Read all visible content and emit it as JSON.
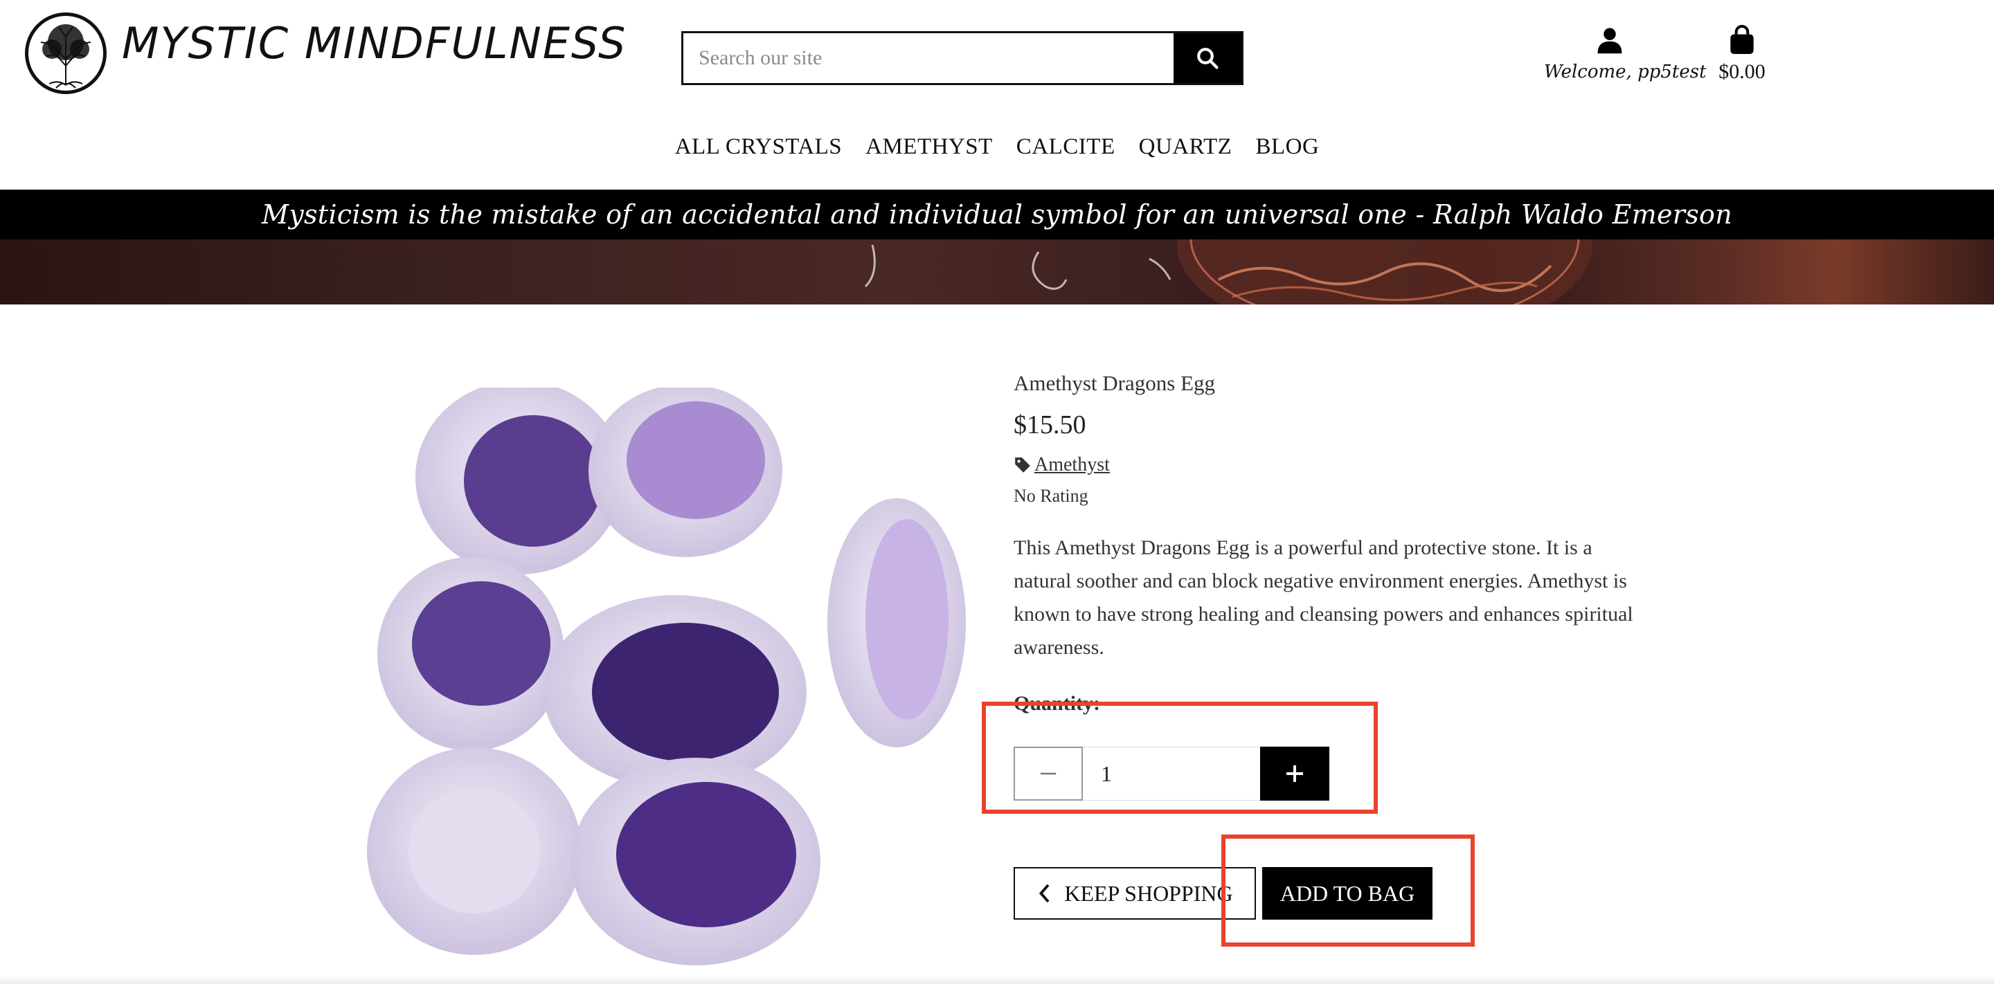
{
  "header": {
    "brand": "MYSTIC MINDFULNESS",
    "search_placeholder": "Search our site",
    "account_label": "Welcome, pp5test",
    "bag_total": "$0.00"
  },
  "nav": {
    "items": [
      "ALL CRYSTALS",
      "AMETHYST",
      "CALCITE",
      "QUARTZ",
      "BLOG"
    ]
  },
  "banner": {
    "quote": "Mysticism is the mistake of an accidental and individual symbol for an universal one - Ralph Waldo Emerson"
  },
  "product": {
    "name": "Amethyst Dragons Egg",
    "price": "$15.50",
    "category": "Amethyst",
    "rating": "No Rating",
    "description": "This Amethyst Dragons Egg is a powerful and protective stone. It is a natural soother and can block negative environment energies. Amethyst is known to have strong healing and cleansing powers and enhances spiritual awareness.",
    "quantity_label": "Quantity:",
    "quantity_value": "1",
    "keep_shopping_label": "KEEP SHOPPING",
    "add_to_bag_label": "ADD TO BAG"
  },
  "icons": {
    "search": "search-icon",
    "account": "user-icon",
    "bag": "shopping-bag-icon",
    "tag": "tag-icon",
    "minus": "minus-icon",
    "plus": "plus-icon",
    "back": "chevron-left-icon"
  },
  "colors": {
    "highlight": "#e8432d",
    "primary_button": "#000000",
    "quote_bar": "#000000"
  }
}
